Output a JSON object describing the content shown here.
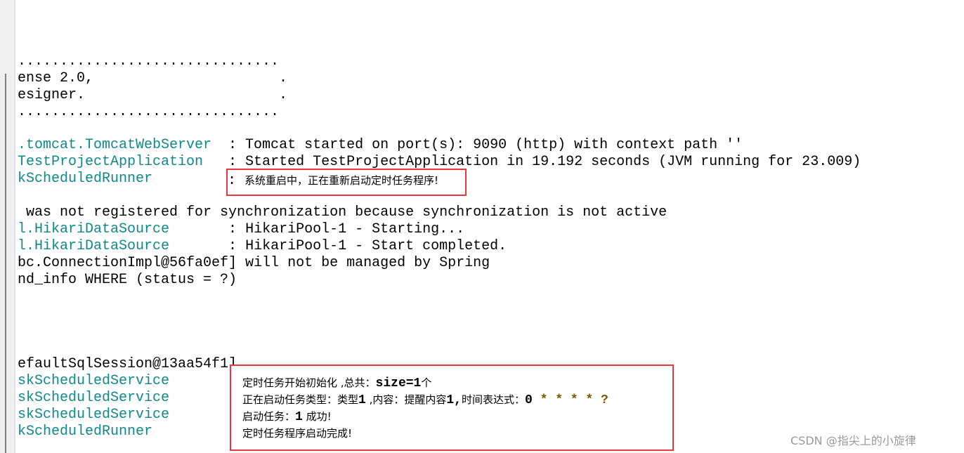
{
  "console": {
    "lines": [
      {
        "cls": "",
        "text": "..............................."
      },
      {
        "cls": "",
        "text": "ense 2.0,                      ."
      },
      {
        "cls": "",
        "text": "esigner.                       ."
      },
      {
        "cls": "",
        "text": "..............................."
      },
      {
        "cls": ".tomcat.TomcatWebServer",
        "text": "  : Tomcat started on port(s): 9090 (http) with context path ''"
      },
      {
        "cls": "TestProjectApplication",
        "text": "   : Started TestProjectApplication in 19.192 seconds (JVM running for 23.009)"
      },
      {
        "cls": "kScheduledRunner",
        "text": ""
      },
      {
        "cls": "",
        "text": " was not registered for synchronization because synchronization is not active"
      },
      {
        "cls": "l.HikariDataSource",
        "text": "       : HikariPool-1 - Starting..."
      },
      {
        "cls": "l.HikariDataSource",
        "text": "       : HikariPool-1 - Start completed."
      },
      {
        "cls": "",
        "text": "bc.ConnectionImpl@56fa0ef] will not be managed by Spring"
      },
      {
        "cls": "nd_info WHERE (status = ?)",
        "text": ""
      },
      {
        "cls": "",
        "text": "efaultSqlSession@13aa54f1]"
      },
      {
        "cls": "skScheduledService",
        "text": ""
      },
      {
        "cls": "skScheduledService",
        "text": ""
      },
      {
        "cls": "skScheduledService",
        "text": ""
      },
      {
        "cls": "kScheduledRunner",
        "text": ""
      }
    ],
    "highlight1": {
      "colon": ": ",
      "message": "系统重启中，正在重新启动定时任务程序!"
    },
    "highlight2": {
      "line1_a": "定时任务开始初始化 ,总共：",
      "line1_b": "size=1",
      "line1_c": "个",
      "line2_a": "正在启动任务类型：类型",
      "line2_b": "1",
      "line2_c": " ,内容：提醒内容",
      "line2_d": "1,",
      "line2_e": "时间表达式：",
      "line2_f": "0",
      "line2_g": " * * * * ?",
      "line3_a": "启动任务：",
      "line3_b": "1",
      "line3_c": " 成功!",
      "line4": "定时任务程序启动完成!"
    },
    "highlight_color": "#e8383d",
    "class_color": "#0f8a8a"
  },
  "watermark": "CSDN @指尖上的小旋律"
}
